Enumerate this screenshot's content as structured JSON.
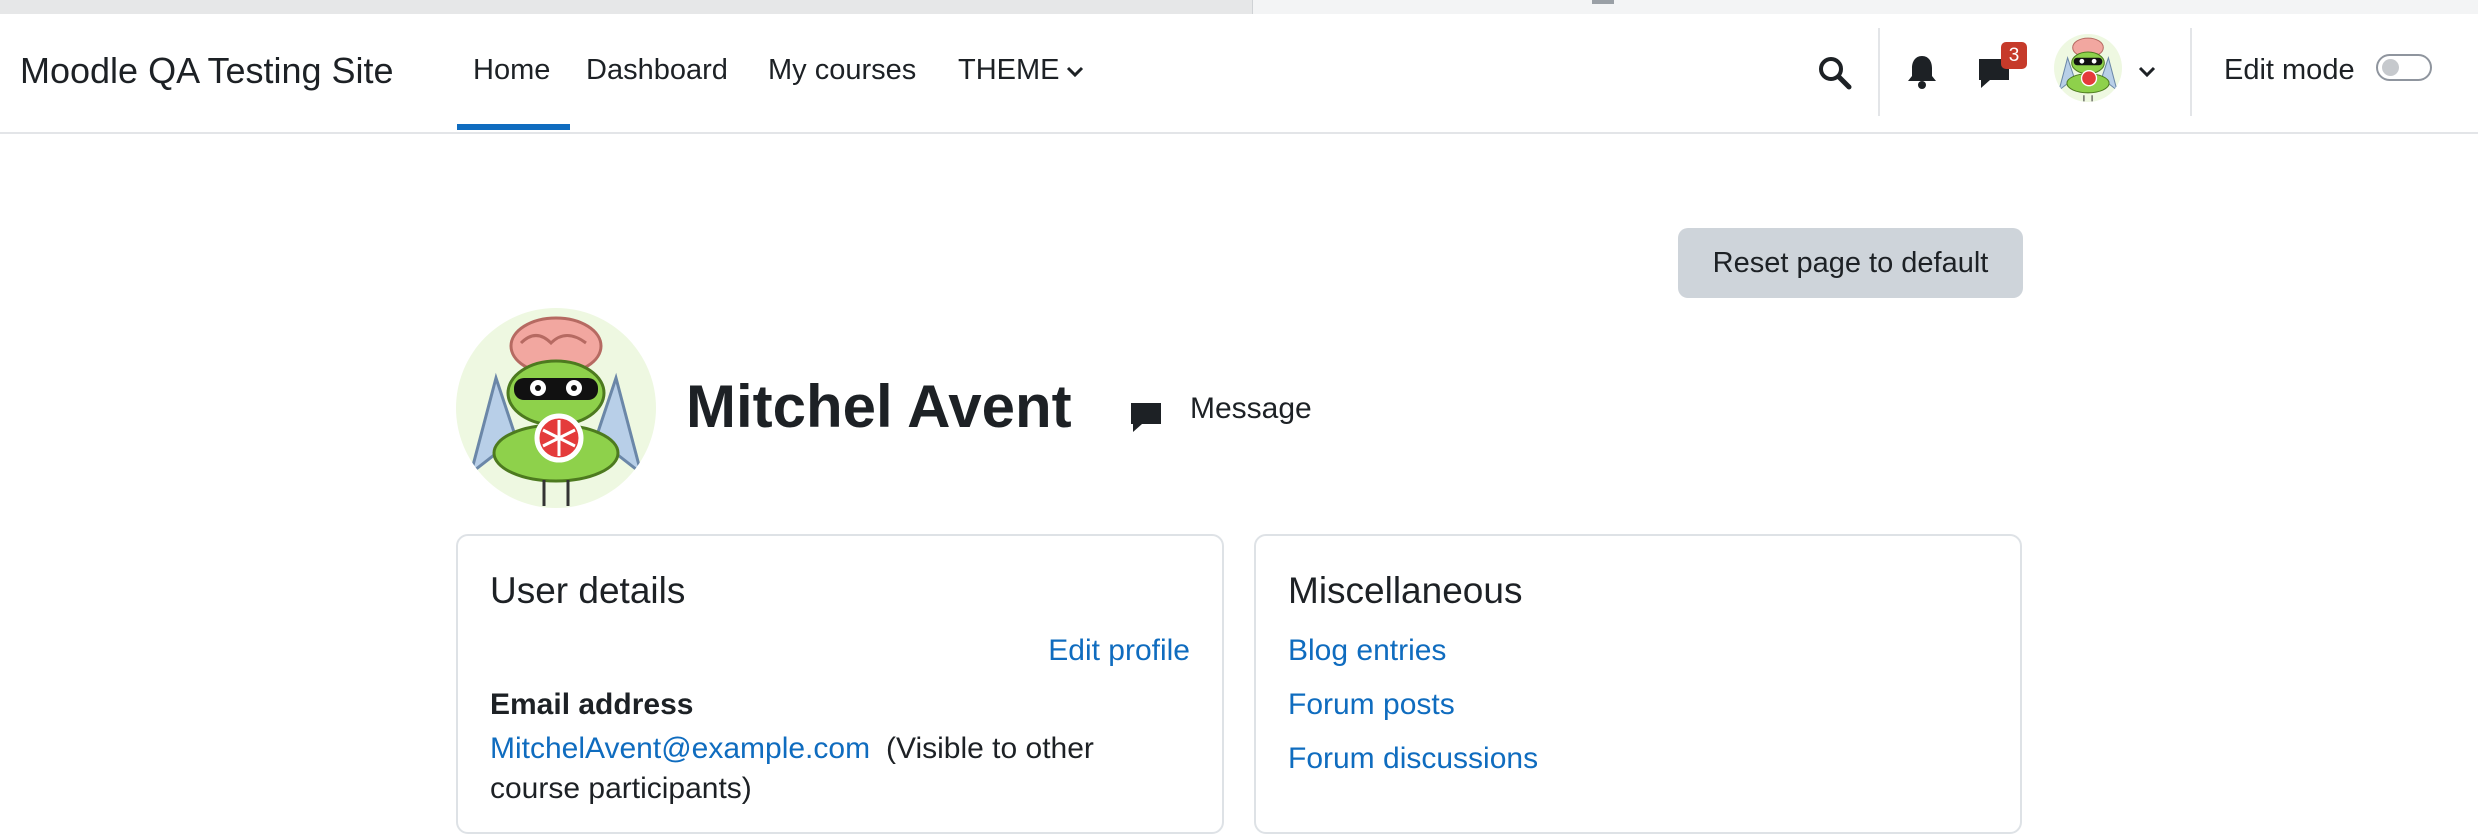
{
  "site": {
    "title": "Moodle QA Testing Site"
  },
  "nav": {
    "items": [
      {
        "label": "Home",
        "active": true
      },
      {
        "label": "Dashboard"
      },
      {
        "label": "My courses"
      },
      {
        "label": "THEME",
        "dropdown": true
      }
    ]
  },
  "header_actions": {
    "search_icon": "search-icon",
    "notifications_icon": "bell-icon",
    "messages_icon": "chat-icon",
    "messages_badge": "3",
    "user_menu_icon": "chevron-down-icon",
    "edit_mode_label": "Edit mode",
    "edit_mode_on": false
  },
  "page": {
    "reset_button": "Reset page to default",
    "profile_name": "Mitchel Avent",
    "message_label": "Message"
  },
  "user_details": {
    "title": "User details",
    "edit_profile": "Edit profile",
    "email_heading": "Email address",
    "email": "MitchelAvent@example.com",
    "email_note_line1": "(Visible to other",
    "email_note_line2": "course participants)"
  },
  "misc": {
    "title": "Miscellaneous",
    "links": [
      "Blog entries",
      "Forum posts",
      "Forum discussions"
    ]
  },
  "colors": {
    "accent": "#0f6cbf",
    "badge": "#c63a2a",
    "button_gray": "#ced4da"
  }
}
